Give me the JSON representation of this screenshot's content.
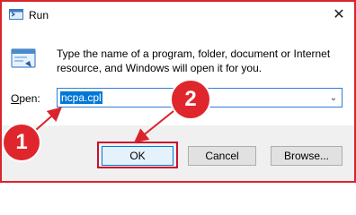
{
  "window": {
    "title": "Run",
    "close_glyph": "✕",
    "border_color": "#d9242c"
  },
  "description": "Type the name of a program, folder, document or Internet resource, and Windows will open it for you.",
  "open": {
    "label_prefix": "O",
    "label_rest": "pen:",
    "value": "ncpa.cpl",
    "dropdown_glyph": "⌄"
  },
  "buttons": {
    "ok": "OK",
    "cancel": "Cancel",
    "browse": "Browse..."
  },
  "annotations": {
    "step1": "1",
    "step2": "2",
    "color": "#e0262d"
  },
  "icons": {
    "app": "run-icon",
    "main": "run-icon",
    "close": "close-icon",
    "dropdown": "chevron-down-icon"
  }
}
